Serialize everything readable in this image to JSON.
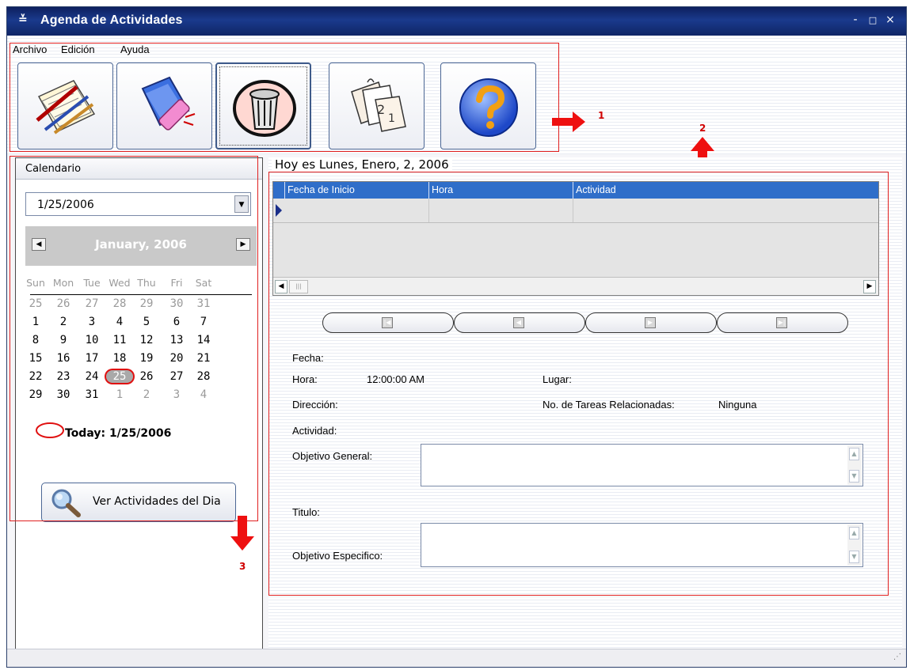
{
  "window": {
    "title": "Agenda de Actividades",
    "app_icon": "≚",
    "controls": [
      "-",
      "□",
      "×"
    ]
  },
  "menu": {
    "archivo": "Archivo",
    "edicion": "Edición",
    "ayuda": "Ayuda"
  },
  "toolbar": {
    "buttons": [
      "new-note-icon",
      "eraser-icon",
      "trash-icon",
      "calendar-pages-icon",
      "help-icon"
    ]
  },
  "annotations": {
    "one": "1",
    "two": "2",
    "three": "3"
  },
  "calendar": {
    "header": "Calendario",
    "selected_date": "1/25/2006",
    "month_title": "January, 2006",
    "days_of_week": [
      "Sun",
      "Mon",
      "Tue",
      "Wed",
      "Thu",
      "Fri",
      "Sat"
    ],
    "weeks": [
      [
        "25",
        "26",
        "27",
        "28",
        "29",
        "30",
        "31"
      ],
      [
        "1",
        "2",
        "3",
        "4",
        "5",
        "6",
        "7"
      ],
      [
        "8",
        "9",
        "10",
        "11",
        "12",
        "13",
        "14"
      ],
      [
        "15",
        "16",
        "17",
        "18",
        "19",
        "20",
        "21"
      ],
      [
        "22",
        "23",
        "24",
        "25",
        "26",
        "27",
        "28"
      ],
      [
        "29",
        "30",
        "31",
        "1",
        "2",
        "3",
        "4"
      ]
    ],
    "today_label": "Today: 1/25/2006",
    "ver_button": "Ver Actividades del Dia"
  },
  "main": {
    "hoy": "Hoy es Lunes, Enero, 2, 2006",
    "grid_columns": [
      "Fecha de Inicio",
      "Hora",
      "Actividad"
    ],
    "fields": {
      "fecha": "Fecha:",
      "hora": "Hora:",
      "hora_value": "12:00:00 AM",
      "lugar": "Lugar:",
      "direccion": "Dirección:",
      "tareas": "No. de Tareas Relacionadas:",
      "tareas_value": "Ninguna",
      "actividad": "Actividad:",
      "objetivo_general": "Objetivo General:",
      "titulo": "Titulo:",
      "objetivo_especifico": "Objetivo Especifico:"
    }
  }
}
